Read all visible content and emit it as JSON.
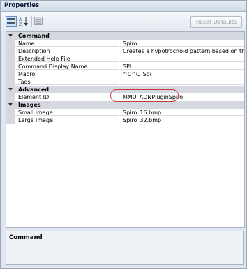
{
  "window": {
    "title": "Properties"
  },
  "toolbar": {
    "reset_label": "Reset Defaults"
  },
  "categories": [
    {
      "label": "Command",
      "properties": [
        {
          "name": "Name",
          "value": "Spiro"
        },
        {
          "name": "Description",
          "value": "Creates a hypotrochoid pattern based on the specified"
        },
        {
          "name": "Extended Help File",
          "value": ""
        },
        {
          "name": "Command Display Name",
          "value": "SPI"
        },
        {
          "name": "Macro",
          "value": "^C^C_Spi"
        },
        {
          "name": "Tags",
          "value": ""
        }
      ]
    },
    {
      "label": "Advanced",
      "properties": [
        {
          "name": "Element ID",
          "value": "MMU_ADNPluginSpiro"
        }
      ]
    },
    {
      "label": "Images",
      "properties": [
        {
          "name": "Small image",
          "value": "Spiro_16.bmp"
        },
        {
          "name": "Large image",
          "value": "Spiro_32.bmp"
        }
      ]
    }
  ],
  "description_panel": {
    "title": "Command"
  },
  "icons": {
    "categorized": "categorized-view-icon",
    "alphabetical": "alphabetical-sort-icon",
    "pages": "property-pages-icon"
  },
  "colors": {
    "highlight_ring": "#c63a3a"
  }
}
